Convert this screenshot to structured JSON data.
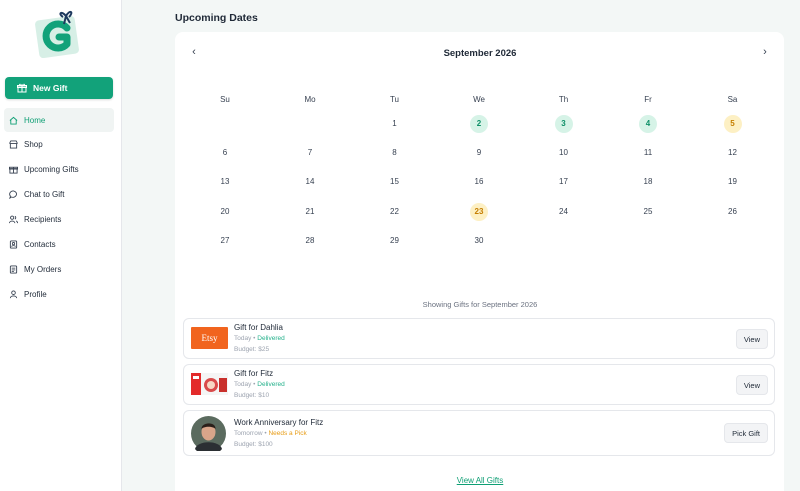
{
  "sidebar": {
    "new_gift_label": "New Gift",
    "items": [
      {
        "label": "Home",
        "icon": "home-icon",
        "active": true
      },
      {
        "label": "Shop",
        "icon": "shop-icon"
      },
      {
        "label": "Upcoming Gifts",
        "icon": "gift-icon"
      },
      {
        "label": "Chat to Gift",
        "icon": "chat-icon"
      },
      {
        "label": "Recipients",
        "icon": "users-icon"
      },
      {
        "label": "Contacts",
        "icon": "contacts-icon"
      },
      {
        "label": "My Orders",
        "icon": "orders-icon"
      },
      {
        "label": "Profile",
        "icon": "user-icon"
      }
    ]
  },
  "main": {
    "title": "Upcoming Dates",
    "calendar": {
      "month_label": "September 2026",
      "prev_symbol": "‹",
      "next_symbol": "›",
      "weekdays": [
        "Su",
        "Mo",
        "Tu",
        "We",
        "Th",
        "Fr",
        "Sa"
      ],
      "first_weekday_index": 2,
      "days_in_month": 30,
      "highlighted": {
        "2": "green",
        "3": "green",
        "4": "green",
        "5": "yellow",
        "23": "yellow"
      }
    },
    "showing_label": "Showing Gifts for September 2026",
    "gifts": [
      {
        "title": "Gift for Dahlia",
        "when": "Today",
        "status": "Delivered",
        "status_type": "delivered",
        "budget": "Budget: $25",
        "action": "View",
        "thumb": "etsy-logo",
        "thumb_text": "Etsy"
      },
      {
        "title": "Gift for Fitz",
        "when": "Today",
        "status": "Delivered",
        "status_type": "delivered",
        "budget": "Budget: $10",
        "action": "View",
        "thumb": "product-image"
      },
      {
        "title": "Work Anniversary for Fitz",
        "when": "Tomorrow",
        "status": "Needs a Pick",
        "status_type": "needs",
        "budget": "Budget: $100",
        "action": "Pick Gift",
        "thumb": "avatar-photo"
      }
    ],
    "separator": "•",
    "view_all_label": "View All Gifts"
  },
  "colors": {
    "brand": "#12a27a",
    "delivered": "#22b08a",
    "needs_pick": "#e79c16",
    "highlight_green": "#d6f3e7",
    "highlight_yellow": "#fdf0c4"
  }
}
